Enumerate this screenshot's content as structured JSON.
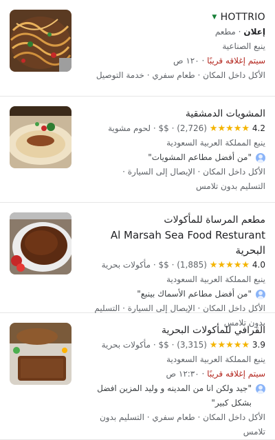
{
  "restaurants": [
    {
      "name": "HOTTRIO",
      "name_latin": true,
      "ad_label": "إعلان",
      "category": "مطعم",
      "location": "ينبع الصناعية",
      "closing_text": "سيتم إغلاقه قريبًا",
      "closing_time": "١٢٠ ص",
      "services": "الأكل داخل المكان · طعام سفري · خدمة التوصيل"
    },
    {
      "name": "المشويات الدمشقية",
      "rating": "4.2",
      "stars": "★★★★★",
      "reviews": "(2,726)",
      "price": "$$",
      "category": "لحوم مشوية",
      "location": "ينبع المملكة العربية السعودية",
      "review_text": "\"من أفضل مطاعم المشويات\"",
      "services_1": "الأكل داخل المكان · الإيصال إلى السيارة ·",
      "services_2": "التسليم بدون تلامس"
    },
    {
      "name_ar": "مطعم المرساة للمأكولات",
      "name_2": "Al Marsah Sea Food Resturant البحرية",
      "rating": "4.0",
      "stars": "★★★★★",
      "reviews": "(1,885)",
      "price": "$$",
      "category": "مأكولات بحرية",
      "location": "ينبع المملكة العربية السعودية",
      "review_text": "\"من أفضل مطاعم الأسماك بينبع\"",
      "services": "الأكل داخل المكان · الإيصال إلى السيارة · التسليم بدون تلامس"
    },
    {
      "name": "القرافي للمأكولات البحرية",
      "rating": "3.9",
      "stars": "★★★★★",
      "reviews": "(3,315)",
      "price": "$$",
      "category": "مأكولات بحرية",
      "location": "ينبع المملكة العربية السعودية",
      "closing_text": "سيتم إغلاقه قريبًا",
      "closing_time": "١٢:٣٠ ص",
      "review_text": "\"جيد ولكن انا من المدينه و وليد المزين افضل بشكل كبير\"",
      "services": "الأكل داخل المكان · طعام سفري · التسليم بدون تلامس"
    }
  ],
  "colors": {
    "star": "#f4b400",
    "closing": "#b3261e",
    "ad_caret": "#188038"
  }
}
